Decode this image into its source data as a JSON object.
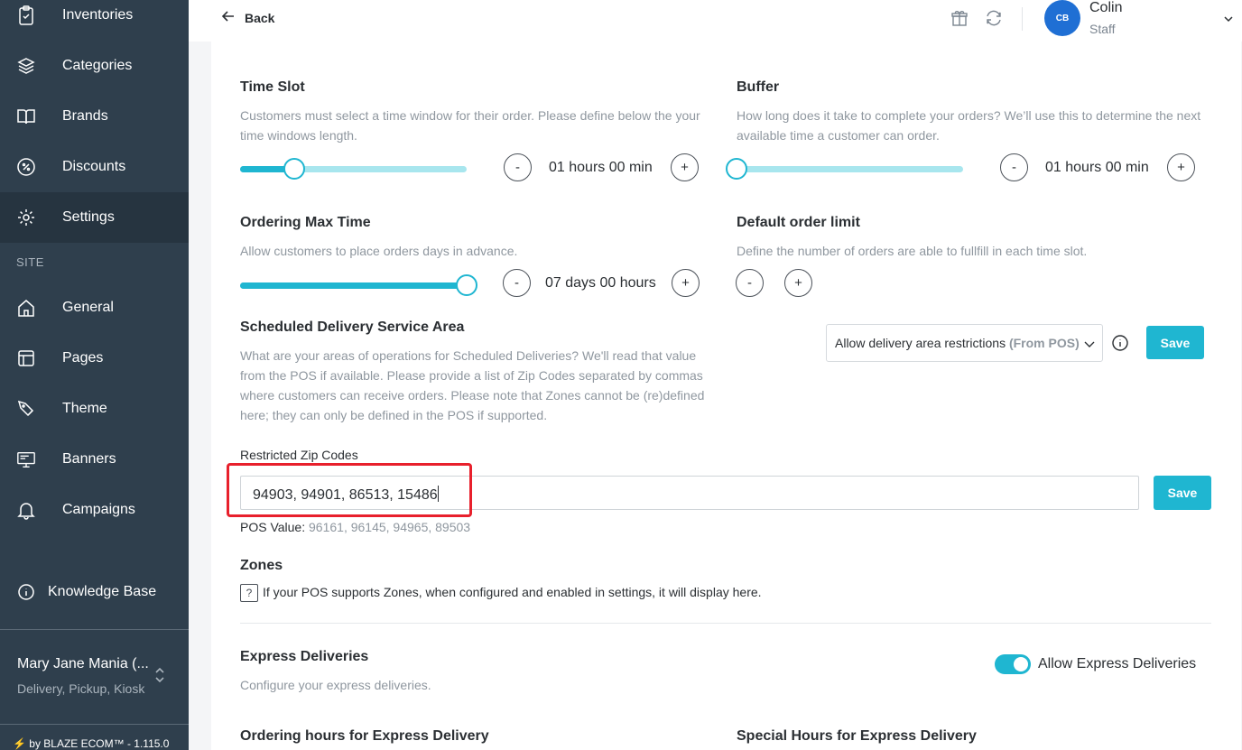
{
  "sidebar": {
    "items_top": [
      {
        "label": "Inventories",
        "icon": "clipboard-icon"
      },
      {
        "label": "Categories",
        "icon": "layers-icon"
      },
      {
        "label": "Brands",
        "icon": "book-icon"
      },
      {
        "label": "Discounts",
        "icon": "percent-icon"
      },
      {
        "label": "Settings",
        "icon": "gear-icon"
      }
    ],
    "section": "SITE",
    "items_site": [
      {
        "label": "General",
        "icon": "home-icon"
      },
      {
        "label": "Pages",
        "icon": "layout-icon"
      },
      {
        "label": "Theme",
        "icon": "brush-icon"
      },
      {
        "label": "Banners",
        "icon": "monitor-icon"
      },
      {
        "label": "Campaigns",
        "icon": "bell-icon"
      }
    ],
    "knowledge_base": "Knowledge Base",
    "store_name": "Mary Jane Mania (...",
    "store_modes": "Delivery, Pickup, Kiosk",
    "footer": "⚡ by BLAZE ECOM™ - 1.115.0"
  },
  "topbar": {
    "back_label": "Back",
    "user_initials": "CB",
    "user_name": "Colin",
    "user_role": "Staff"
  },
  "time_slot": {
    "title": "Time Slot",
    "description": "Customers must select a time window for their order. Please define below the your time windows length.",
    "value": "01 hours 00 min",
    "level": 0.24
  },
  "buffer": {
    "title": "Buffer",
    "description": "How long does it take to complete your orders? We’ll use this to determine the next available time a customer can order.",
    "value": "01 hours 00 min",
    "level": 0.0
  },
  "ordering_max_time": {
    "title": "Ordering Max Time",
    "description": "Allow customers to place orders days in advance.",
    "value": "07 days 00 hours",
    "level": 1.0
  },
  "default_order_limit": {
    "title": "Default order limit",
    "description": "Define the number of orders are able to fullfill in each time slot."
  },
  "stepper": {
    "minus": "-",
    "plus": "+"
  },
  "scheduled_area": {
    "title": "Scheduled Delivery Service Area",
    "description": "What are your areas of operations for Scheduled Deliveries? We'll read that value from the POS if available. Please provide a list of Zip Codes separated by commas where customers can receive orders. Please note that Zones cannot be (re)defined here; they can only be defined in the POS if supported.",
    "select_label": "Allow delivery area restrictions",
    "select_suffix": "(From POS)",
    "save_label": "Save"
  },
  "restricted_zip": {
    "label": "Restricted Zip Codes",
    "value": "94903, 94901, 86513, 15486",
    "save_label": "Save",
    "pos_label": "POS Value:",
    "pos_value": "96161, 96145, 94965, 89503"
  },
  "zones": {
    "title": "Zones",
    "icon_glyph": "?",
    "text": "If your POS supports Zones, when configured and enabled in settings, it will display here."
  },
  "express": {
    "title": "Express Deliveries",
    "description": "Configure your express deliveries.",
    "toggle_label": "Allow Express Deliveries",
    "toggle_on": true
  },
  "express_hours": {
    "ordering_title": "Ordering hours for Express Delivery",
    "special_title": "Special Hours for Express Delivery"
  },
  "colors": {
    "accent": "#1fb6d1",
    "sidebar": "#2f3f4d",
    "highlight": "#e8202c"
  }
}
